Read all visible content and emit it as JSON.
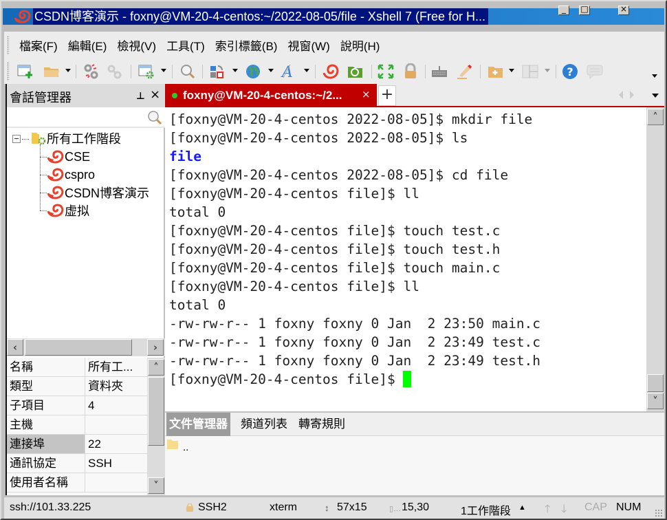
{
  "window": {
    "title": "CSDN博客演示 - foxny@VM-20-4-centos:~/2022-08-05/file - Xshell 7 (Free for H...",
    "controls": {
      "minimize": "_",
      "maximize": "□",
      "close": "×"
    }
  },
  "menu": {
    "items": [
      "檔案(F)",
      "編輯(E)",
      "檢視(V)",
      "工具(T)",
      "索引標籤(B)",
      "視窗(W)",
      "說明(H)"
    ]
  },
  "toolbar": {
    "icons": [
      "new-session-icon",
      "open-folder-icon",
      "disconnect-icon",
      "reconnect-icon",
      "session-properties-icon",
      "find-icon",
      "transfer-icon",
      "globe-icon",
      "font-icon",
      "xshell-icon",
      "xftp-icon",
      "fullscreen-icon",
      "lock-icon",
      "keyboard-icon",
      "highlight-icon",
      "new-folder-icon",
      "layout-icon",
      "help-icon",
      "chat-icon"
    ]
  },
  "session_manager": {
    "title": "會話管理器",
    "pin": "▮",
    "close": "×",
    "search_placeholder": "",
    "tree": {
      "root": "所有工作階段",
      "children": [
        "CSE",
        "cspro",
        "CSDN博客演示",
        "虚拟"
      ]
    },
    "properties": [
      {
        "key": "名稱",
        "value": "所有工..."
      },
      {
        "key": "類型",
        "value": "資料夾"
      },
      {
        "key": "子項目",
        "value": "4"
      },
      {
        "key": "主機",
        "value": ""
      },
      {
        "key": "連接埠",
        "value": "22"
      },
      {
        "key": "通訊協定",
        "value": "SSH"
      },
      {
        "key": "使用者名稱",
        "value": ""
      }
    ],
    "selected_property": "連接埠"
  },
  "tabs": {
    "active": {
      "label": "foxny@VM-20-4-centos:~/2...",
      "close": "×",
      "status_color": "#2ec82e"
    },
    "new_tab": "+"
  },
  "terminal": {
    "lines": [
      {
        "text": "[foxny@VM-20-4-centos 2022-08-05]$ mkdir file",
        "type": "normal"
      },
      {
        "text": "[foxny@VM-20-4-centos 2022-08-05]$ ls",
        "type": "normal"
      },
      {
        "text": "file",
        "type": "dir"
      },
      {
        "text": "[foxny@VM-20-4-centos 2022-08-05]$ cd file",
        "type": "normal"
      },
      {
        "text": "[foxny@VM-20-4-centos file]$ ll",
        "type": "normal"
      },
      {
        "text": "total 0",
        "type": "normal"
      },
      {
        "text": "[foxny@VM-20-4-centos file]$ touch test.c",
        "type": "normal"
      },
      {
        "text": "[foxny@VM-20-4-centos file]$ touch test.h",
        "type": "normal"
      },
      {
        "text": "[foxny@VM-20-4-centos file]$ touch main.c",
        "type": "normal"
      },
      {
        "text": "[foxny@VM-20-4-centos file]$ ll",
        "type": "normal"
      },
      {
        "text": "total 0",
        "type": "normal"
      },
      {
        "text": "-rw-rw-r-- 1 foxny foxny 0 Jan  2 23:50 main.c",
        "type": "normal"
      },
      {
        "text": "-rw-rw-r-- 1 foxny foxny 0 Jan  2 23:49 test.c",
        "type": "normal"
      },
      {
        "text": "-rw-rw-r-- 1 foxny foxny 0 Jan  2 23:49 test.h",
        "type": "normal"
      }
    ],
    "prompt": "[foxny@VM-20-4-centos file]$ ",
    "cursor_color": "#00ff00",
    "dir_color": "#1a1aff"
  },
  "bottom_panel": {
    "tabs": [
      "文件管理器",
      "頻道列表",
      "轉寄規則"
    ],
    "active_tab": "文件管理器",
    "files": [
      ".."
    ]
  },
  "statusbar": {
    "address": "ssh://101.33.225",
    "protocol": "SSH2",
    "terminal_type": "xterm",
    "size": "57x15",
    "cursor_pos": "15,30",
    "sessions": "1工作階段",
    "cap": "CAP",
    "num": "NUM"
  },
  "colors": {
    "accent_tab": "#c00000",
    "title_highlight": "#00127e"
  }
}
